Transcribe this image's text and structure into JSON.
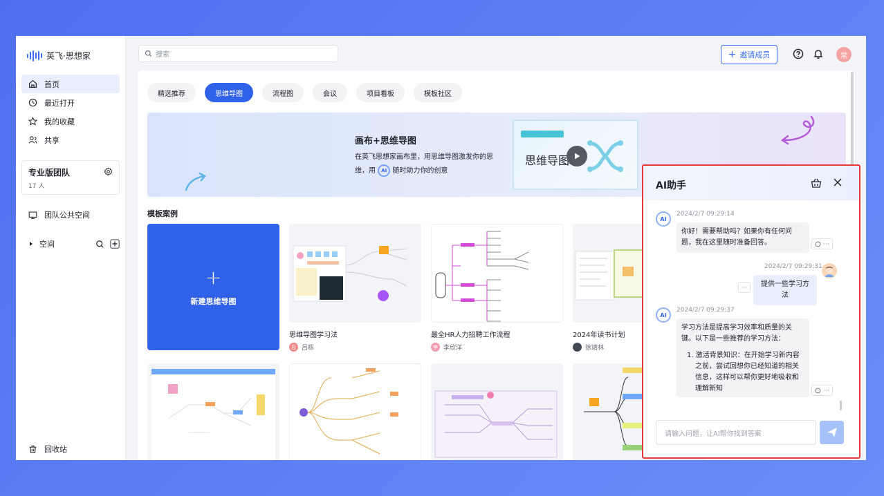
{
  "app": {
    "brand": "英飞·思想家"
  },
  "sidebar": {
    "items": [
      {
        "label": "首页",
        "icon": "home-icon",
        "active": true
      },
      {
        "label": "最近打开",
        "icon": "clock-icon"
      },
      {
        "label": "我的收藏",
        "icon": "star-icon"
      },
      {
        "label": "共享",
        "icon": "share-users-icon"
      }
    ],
    "team": {
      "name": "专业版团队",
      "count": "17 人"
    },
    "public_space": "团队公共空间",
    "space": "空间",
    "recycle": "回收站"
  },
  "topbar": {
    "search_placeholder": "搜索",
    "invite_label": "邀请成员",
    "avatar_text": "常"
  },
  "tabs": [
    "精选推荐",
    "思维导图",
    "流程图",
    "会议",
    "项目看板",
    "模板社区"
  ],
  "banner": {
    "title": "画布+思维导图",
    "desc1": "在英飞思想家画布里，用思维导图激发你的思",
    "desc2_pre": "维，用",
    "desc2_post": "随时助力你的创意",
    "video_title": "思维导图",
    "ai_badge": "AI"
  },
  "section_title": "模板案例",
  "new_card_label": "新建思维导图",
  "templates": [
    {
      "name": "思维导图学习法",
      "author": "吕栋",
      "avatar_char": "吕",
      "avatar_color": "#f08a8a"
    },
    {
      "name": "最全HR人力招聘工作流程",
      "author": "李欣洋",
      "avatar_char": "李",
      "avatar_color": "#f29bb0"
    },
    {
      "name": "2024年读书计划",
      "author": "徐靖林",
      "avatar_char": "",
      "avatar_color": "#444a55"
    }
  ],
  "ai": {
    "title": "AI助手",
    "avatar_text": "AI",
    "messages": [
      {
        "role": "ai",
        "time": "2024/2/7 09:29:14",
        "lines": [
          "你好！需要帮助吗？如果你有任何问",
          "题，我在这里随时准备回答。"
        ]
      },
      {
        "role": "user",
        "time": "2024/2/7 09:29:31",
        "lines": [
          "提供一些学习方法"
        ]
      },
      {
        "role": "ai",
        "time": "2024/2/7 09:29:37",
        "lines": [
          "学习方法是提高学习效率和质量的关",
          "键。以下是一些推荐的学习方法：",
          "",
          "1. 激活背景知识：在开始学习新内容",
          "之前，尝试回想你已经知道的相关",
          "信息，这样可以帮你更好地吸收和",
          "理解新知"
        ]
      }
    ],
    "more": "···",
    "input_placeholder": "请输入问题，让AI帮你找到答案"
  },
  "colors": {
    "accent": "#2f62e8",
    "highlight_border": "#e6393c"
  }
}
